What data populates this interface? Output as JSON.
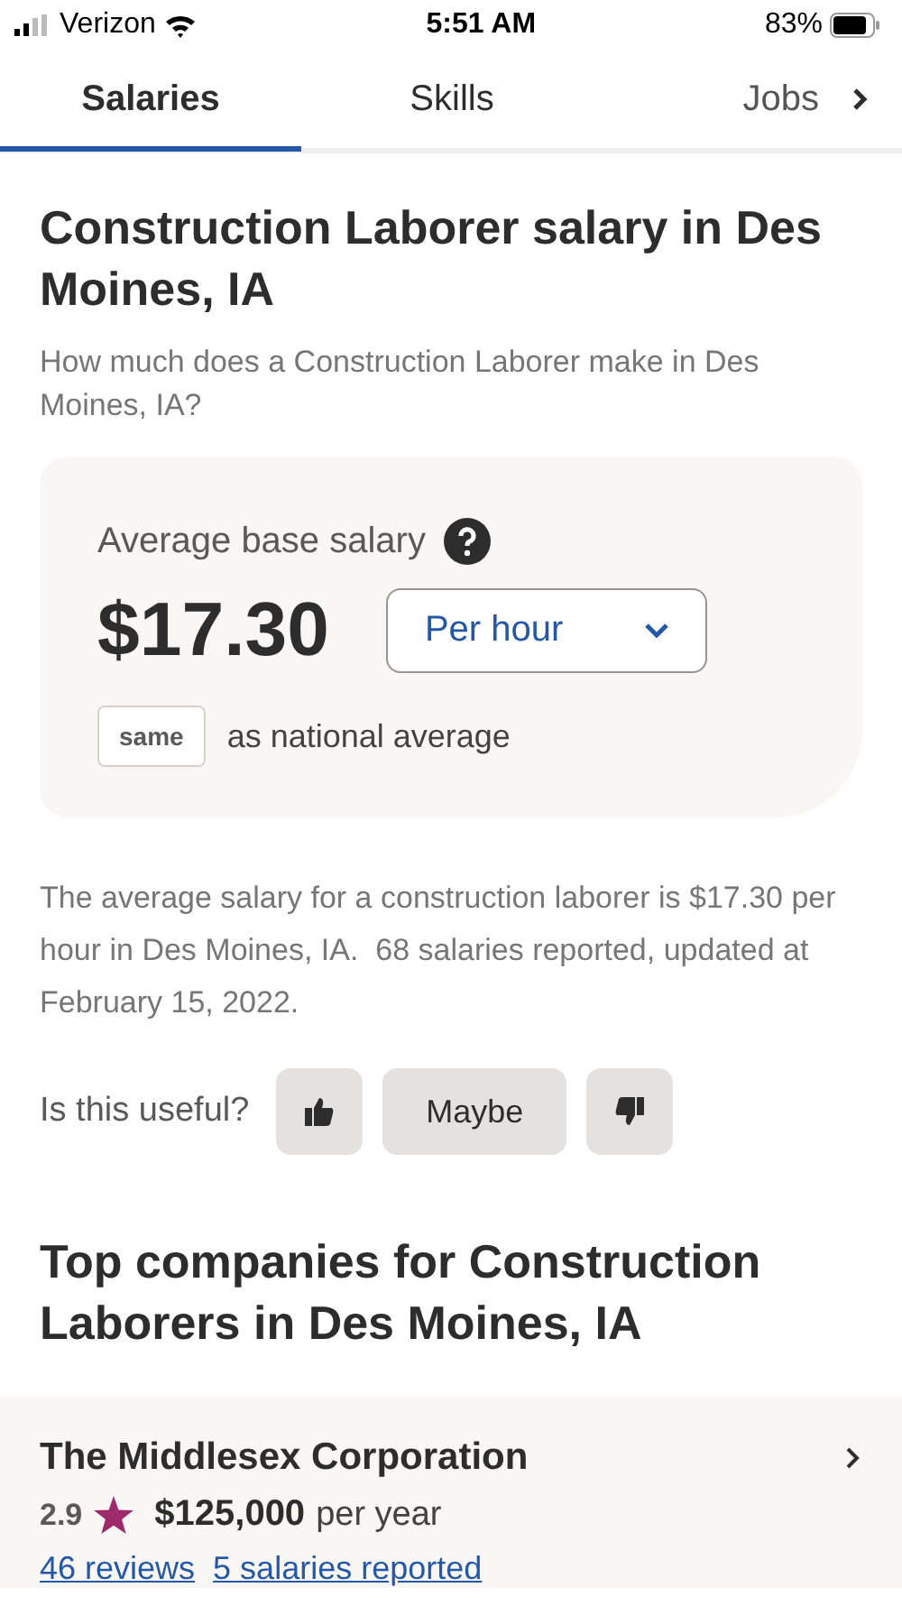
{
  "status_bar": {
    "carrier": "Verizon",
    "time": "5:51 AM",
    "battery": "83%"
  },
  "tabs": [
    {
      "label": "Salaries",
      "selected": true
    },
    {
      "label": "Skills",
      "selected": false
    },
    {
      "label": "Jobs",
      "selected": false
    }
  ],
  "title": "Construction Laborer salary in Des Moines, IA",
  "subtitle": "How much does a Construction Laborer make in Des Moines, IA?",
  "salary_card": {
    "label": "Average base salary",
    "amount": "$17.30",
    "period": "Per hour",
    "comparison_badge": "same",
    "comparison_text": "as national average"
  },
  "summary": "The average salary for a construction laborer is $17.30 per hour in Des Moines, IA.  68 salaries reported, updated at February 15, 2022.",
  "feedback": {
    "question": "Is this useful?",
    "maybe": "Maybe"
  },
  "companies_heading": "Top companies for Construction Laborers in Des Moines, IA",
  "companies": [
    {
      "name": "The Middlesex Corporation",
      "rating": "2.9",
      "salary": "$125,000",
      "period": "per year",
      "reviews": "46 reviews",
      "salaries": "5 salaries reported"
    }
  ]
}
